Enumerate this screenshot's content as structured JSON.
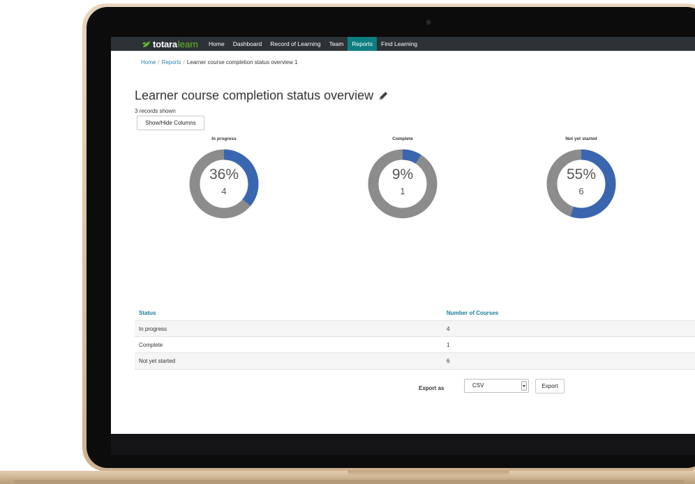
{
  "nav": {
    "brand_main": "totara",
    "brand_sub": "learn",
    "items": [
      {
        "label": "Home",
        "active": false
      },
      {
        "label": "Dashboard",
        "active": false
      },
      {
        "label": "Record of Learning",
        "active": false
      },
      {
        "label": "Team",
        "active": false
      },
      {
        "label": "Reports",
        "active": true
      },
      {
        "label": "Find Learning",
        "active": false
      }
    ]
  },
  "breadcrumb": {
    "home": "Home",
    "reports": "Reports",
    "current": "Learner course completion status overview 1"
  },
  "page": {
    "title": "Learner course completion status overview",
    "records_shown": "3 records shown",
    "show_hide_columns": "Show/Hide Columns"
  },
  "charts": [
    {
      "label": "In progress",
      "percent_text": "36%",
      "count": "4",
      "fraction": 0.36
    },
    {
      "label": "Complete",
      "percent_text": "9%",
      "count": "1",
      "fraction": 0.09
    },
    {
      "label": "Not yet started",
      "percent_text": "55%",
      "count": "6",
      "fraction": 0.55
    }
  ],
  "table": {
    "headers": [
      "Status",
      "Number of Courses"
    ],
    "rows": [
      [
        "In progress",
        "4"
      ],
      [
        "Complete",
        "1"
      ],
      [
        "Not yet started",
        "6"
      ]
    ]
  },
  "export": {
    "label": "Export as",
    "format": "CSV",
    "button": "Export"
  },
  "colors": {
    "nav_bg": "#2d3237",
    "nav_active": "#0d7e82",
    "brand_green": "#69be28",
    "donut_filled": "#3a66b0",
    "donut_remaining": "#8c8c8c",
    "table_header": "#187c99"
  }
}
